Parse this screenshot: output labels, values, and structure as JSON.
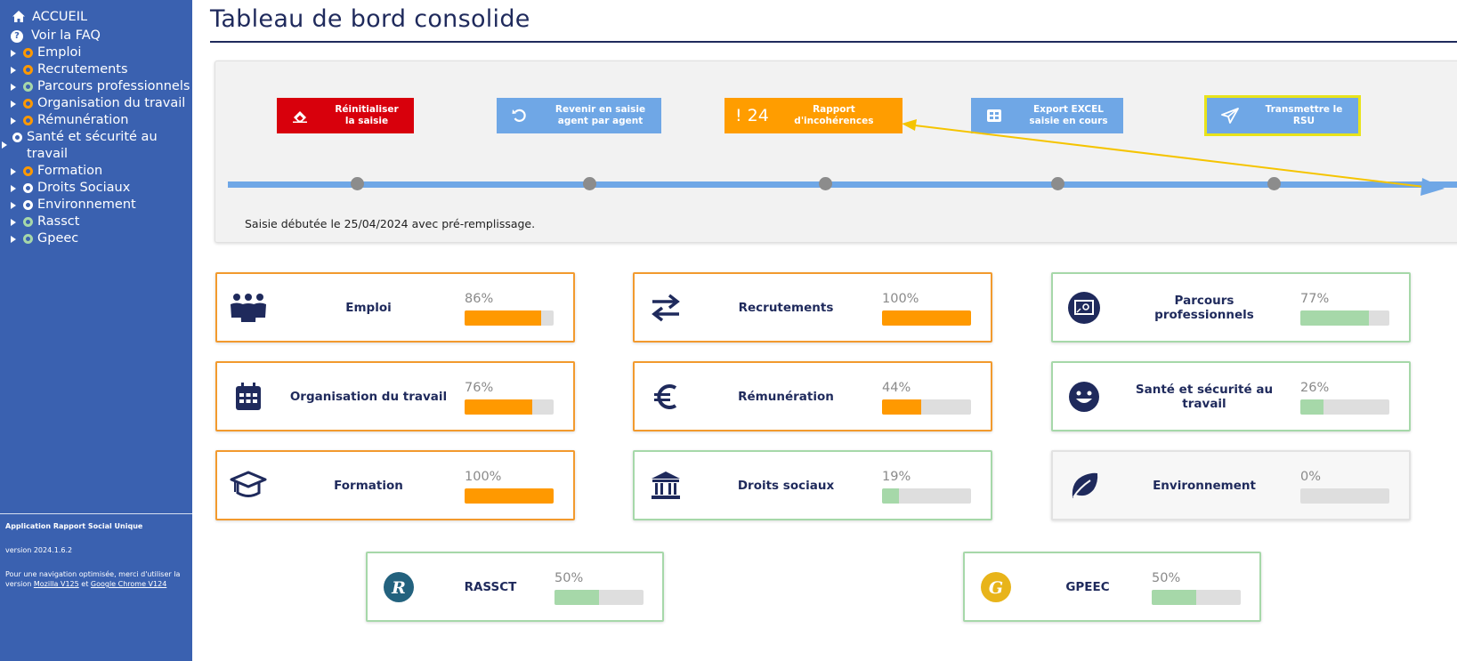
{
  "sidebar": {
    "items": [
      {
        "label": "ACCUEIL"
      },
      {
        "label": "Voir la FAQ"
      },
      {
        "label": "Emploi"
      },
      {
        "label": "Recrutements"
      },
      {
        "label": "Parcours professionnels"
      },
      {
        "label": "Organisation du travail"
      },
      {
        "label": "Rémunération"
      },
      {
        "label": "Santé et sécurité au travail"
      },
      {
        "label": "Formation"
      },
      {
        "label": "Droits Sociaux"
      },
      {
        "label": "Environnement"
      },
      {
        "label": "Rassct"
      },
      {
        "label": "Gpeec"
      }
    ],
    "status_colors": {
      "orange": "#ff9900",
      "green": "#a6d8a9",
      "white": "#ffffff"
    },
    "footer": {
      "app_name": "Application Rapport Social Unique",
      "version": "version 2024.1.6.2",
      "notice_prefix": "Pour une navigation optimisée, merci d'utiliser la version",
      "link_mozilla": "Mozilla V125",
      "notice_and": "et",
      "link_chrome": "Google Chrome V124"
    }
  },
  "header": {
    "title": "Tableau de bord consolide"
  },
  "panel": {
    "buttons": {
      "reset": {
        "line1": "Réinitialiser",
        "line2": "la saisie",
        "icon": "eraser-icon",
        "color": "#d8000c"
      },
      "revenir": {
        "line1": "Revenir en saisie",
        "line2": "agent par agent",
        "icon": "undo-icon",
        "color": "#6fa7e6"
      },
      "rapport": {
        "excl": "!",
        "count": "24",
        "line1": "Rapport",
        "line2": "d'incohérences",
        "color": "#ff9d00"
      },
      "export": {
        "line1": "Export EXCEL",
        "line2": "saisie en cours",
        "icon": "table-icon",
        "color": "#6fa7e6"
      },
      "transmettre": {
        "line1": "Transmettre le",
        "line2": "RSU",
        "icon": "paper-plane-icon",
        "color": "#6fa7e6"
      }
    },
    "saisie_text": "Saisie débutée le 25/04/2024 avec pré-remplissage."
  },
  "cards": {
    "emploi": {
      "label": "Emploi",
      "percent": "86%",
      "progress": 0.86,
      "status": "orange",
      "icon": "people-icon"
    },
    "recrutements": {
      "label": "Recrutements",
      "percent": "100%",
      "progress": 1.0,
      "status": "orange",
      "icon": "exchange-arrows-icon"
    },
    "parcours": {
      "label": "Parcours professionnels",
      "percent": "77%",
      "progress": 0.77,
      "status": "green",
      "icon": "presentation-icon"
    },
    "organisation": {
      "label": "Organisation du travail",
      "percent": "76%",
      "progress": 0.76,
      "status": "orange",
      "icon": "calendar-icon"
    },
    "remuneration": {
      "label": "Rémunération",
      "percent": "44%",
      "progress": 0.44,
      "status": "orange",
      "icon": "euro-icon"
    },
    "sante": {
      "label": "Santé et sécurité au travail",
      "percent": "26%",
      "progress": 0.26,
      "status": "green",
      "icon": "smiley-icon"
    },
    "formation": {
      "label": "Formation",
      "percent": "100%",
      "progress": 1.0,
      "status": "orange",
      "icon": "graduation-cap-icon"
    },
    "droits": {
      "label": "Droits sociaux",
      "percent": "19%",
      "progress": 0.19,
      "status": "green",
      "icon": "institution-icon"
    },
    "environnement": {
      "label": "Environnement",
      "percent": "0%",
      "progress": 0.0,
      "status": "grey",
      "icon": "leaf-icon"
    },
    "rassct": {
      "label": "RASSCT",
      "percent": "50%",
      "progress": 0.5,
      "status": "green",
      "icon": "rassct-logo-icon",
      "icon_letter": "R"
    },
    "gpeec": {
      "label": "GPEEC",
      "percent": "50%",
      "progress": 0.5,
      "status": "green",
      "icon": "gpeec-logo-icon",
      "icon_letter": "G"
    }
  }
}
